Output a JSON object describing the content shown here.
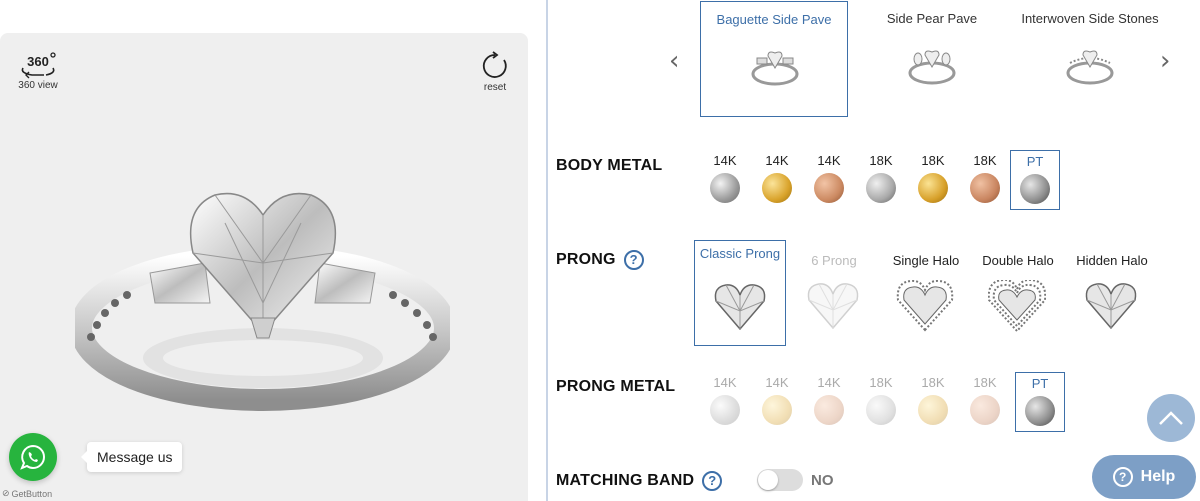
{
  "viewer": {
    "view360_label": "360 view",
    "view360_icon_text": "360",
    "reset_label": "reset"
  },
  "chat": {
    "message_label": "Message us",
    "powered_by": "GetButton"
  },
  "styles": {
    "items": [
      {
        "label": "Baguette Side Pave",
        "selected": true
      },
      {
        "label": "Side Pear Pave",
        "selected": false
      },
      {
        "label": "Interwoven Side Stones",
        "selected": false
      }
    ]
  },
  "body_metal": {
    "label": "BODY METAL",
    "options": [
      {
        "karat": "14K",
        "color": "#b7b7b7",
        "selected": false
      },
      {
        "karat": "14K",
        "color": "#d9a32b",
        "selected": false
      },
      {
        "karat": "14K",
        "color": "#cc8a62",
        "selected": false
      },
      {
        "karat": "18K",
        "color": "#a9a9a9",
        "selected": false
      },
      {
        "karat": "18K",
        "color": "#d7a02a",
        "selected": false
      },
      {
        "karat": "18K",
        "color": "#c98560",
        "selected": false
      },
      {
        "karat": "PT",
        "color": "#8d8d8d",
        "selected": true
      }
    ]
  },
  "prong": {
    "label": "PRONG",
    "help": "?",
    "options": [
      {
        "label": "Classic Prong",
        "selected": true,
        "disabled": false
      },
      {
        "label": "6 Prong",
        "selected": false,
        "disabled": true
      },
      {
        "label": "Single Halo",
        "selected": false,
        "disabled": false
      },
      {
        "label": "Double Halo",
        "selected": false,
        "disabled": false
      },
      {
        "label": "Hidden Halo",
        "selected": false,
        "disabled": false
      }
    ]
  },
  "prong_metal": {
    "label": "PRONG METAL",
    "options": [
      {
        "karat": "14K",
        "color": "#d6d6d6",
        "selected": false
      },
      {
        "karat": "14K",
        "color": "#ecd59a",
        "selected": false
      },
      {
        "karat": "14K",
        "color": "#e9c9bb",
        "selected": false
      },
      {
        "karat": "18K",
        "color": "#d2d2d2",
        "selected": false
      },
      {
        "karat": "18K",
        "color": "#ebd293",
        "selected": false
      },
      {
        "karat": "18K",
        "color": "#e7c6b8",
        "selected": false
      },
      {
        "karat": "PT",
        "color": "#8d8d8d",
        "selected": true
      }
    ]
  },
  "matching_band": {
    "label": "MATCHING BAND",
    "help": "?",
    "toggle_state": "NO"
  },
  "help_button": {
    "label": "Help",
    "icon": "?"
  },
  "colors": {
    "accent": "#3d6fa8",
    "whatsapp": "#27b43e",
    "help": "#7d9fc6"
  }
}
